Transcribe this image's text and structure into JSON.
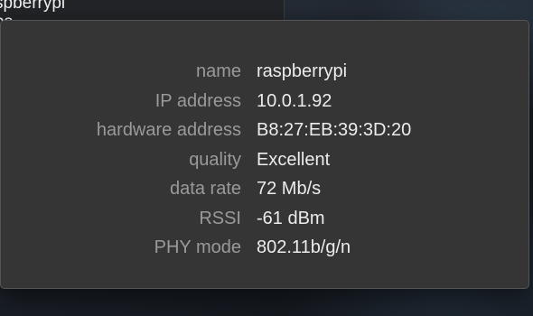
{
  "background_window": {
    "line1": "spberrypi",
    "line2": "ps"
  },
  "info": {
    "rows": [
      {
        "label": "name",
        "value": "raspberrypi"
      },
      {
        "label": "IP address",
        "value": "10.0.1.92"
      },
      {
        "label": "hardware address",
        "value": "B8:27:EB:39:3D:20"
      },
      {
        "label": "quality",
        "value": "Excellent"
      },
      {
        "label": "data rate",
        "value": "72 Mb/s"
      },
      {
        "label": "RSSI",
        "value": "-61 dBm"
      },
      {
        "label": "PHY mode",
        "value": "802.11b/g/n"
      }
    ]
  },
  "colors": {
    "panel_bg": "#353535",
    "label_text": "#9a9a9b",
    "value_text": "#ececec"
  }
}
